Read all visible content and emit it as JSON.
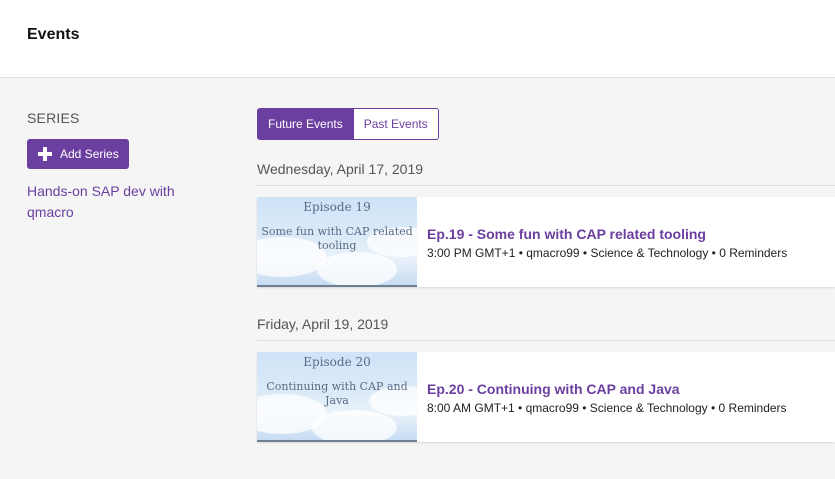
{
  "header": {
    "title": "Events"
  },
  "sidebar": {
    "heading": "SERIES",
    "add_series_label": "Add Series",
    "series_link": "Hands-on SAP dev with qmacro"
  },
  "tabs": {
    "future": "Future Events",
    "past": "Past Events"
  },
  "days": [
    {
      "date": "Wednesday, April 17, 2019",
      "event": {
        "thumb_episode": "Episode 19",
        "thumb_title": "Some fun with CAP related tooling",
        "title": "Ep.19 - Some fun with CAP related tooling",
        "meta": "3:00 PM GMT+1 • qmacro99 • Science & Technology • 0 Reminders"
      }
    },
    {
      "date": "Friday, April 19, 2019",
      "event": {
        "thumb_episode": "Episode 20",
        "thumb_title": "Continuing with CAP and Java",
        "title": "Ep.20 - Continuing with CAP and Java",
        "meta": "8:00 AM GMT+1 • qmacro99 • Science & Technology • 0 Reminders"
      }
    }
  ],
  "colors": {
    "accent": "#6b3fa0",
    "background": "#f5f5f5"
  },
  "icons": {
    "add": "plus-icon"
  }
}
